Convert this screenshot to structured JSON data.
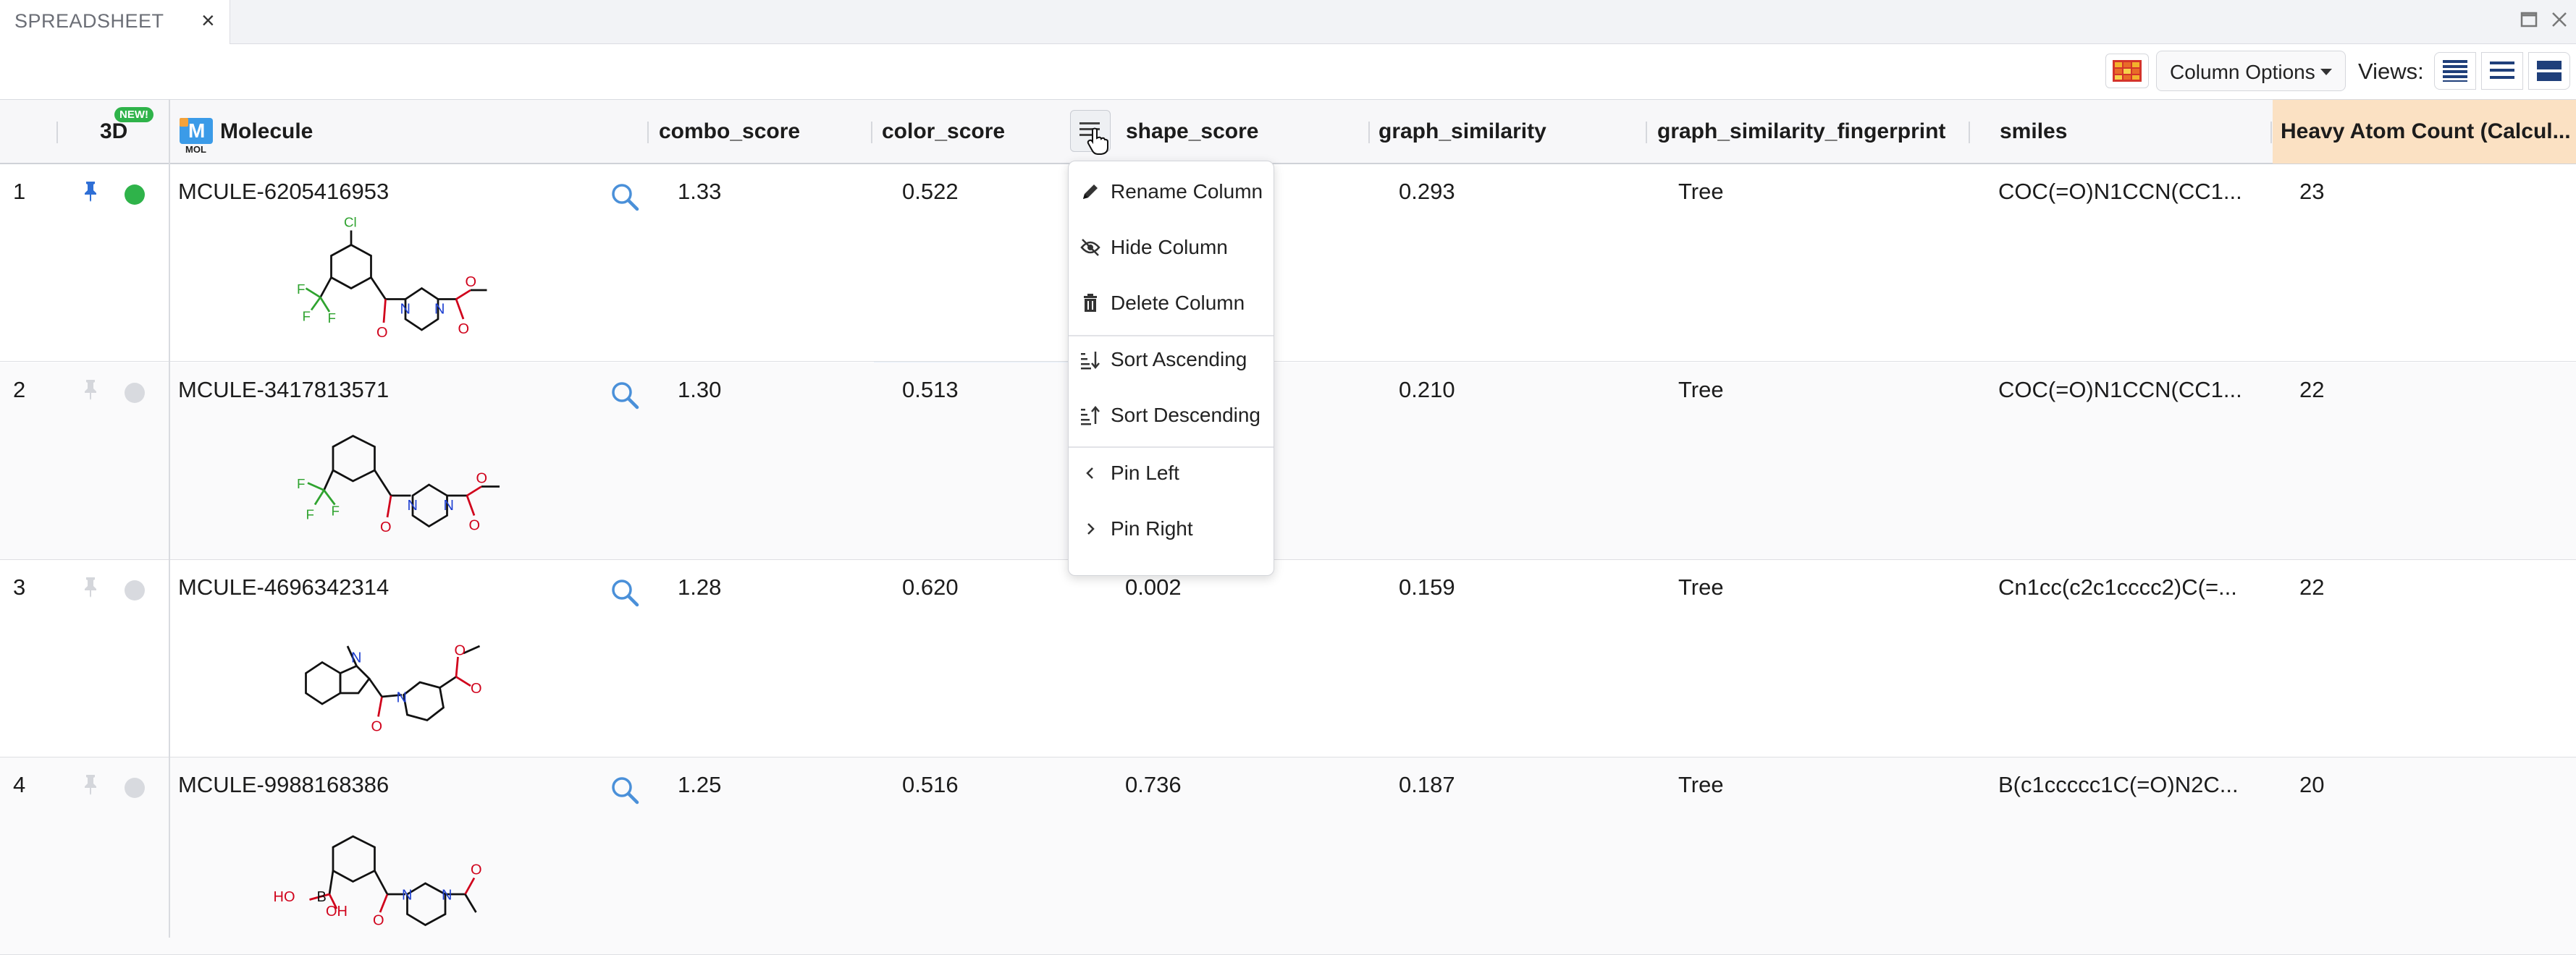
{
  "tab": {
    "title": "SPREADSHEET",
    "close": "×"
  },
  "toolbar": {
    "column_options": "Column Options",
    "views_label": "Views:"
  },
  "header": {
    "threed": "3D",
    "new_badge": "NEW!",
    "mol_badge": "MOL",
    "mol_letter": "M",
    "molecule": "Molecule",
    "combo_score": "combo_score",
    "color_score": "color_score",
    "shape_score": "shape_score",
    "graph_similarity": "graph_similarity",
    "graph_similarity_fingerprint": "graph_similarity_fingerprint",
    "smiles": "smiles",
    "heavy_atom_count": "Heavy Atom Count (Calcul..."
  },
  "menu": {
    "items": [
      {
        "label": "Rename Column",
        "icon": "pencil-icon"
      },
      {
        "label": "Hide Column",
        "icon": "eye-off-icon"
      },
      {
        "label": "Delete Column",
        "icon": "trash-icon"
      },
      {
        "label": "Sort Ascending",
        "icon": "sort-ascending-icon"
      },
      {
        "label": "Sort Descending",
        "icon": "sort-descending-icon"
      },
      {
        "label": "Pin Left",
        "icon": "chevron-left-icon"
      },
      {
        "label": "Pin Right",
        "icon": "chevron-right-icon"
      }
    ]
  },
  "rows": [
    {
      "num": "1",
      "pinned": true,
      "status": "active",
      "id": "MCULE-6205416953",
      "combo": "1.33",
      "color": "0.522",
      "shape": "",
      "graph": "0.293",
      "fingerprint": "Tree",
      "smiles": "COC(=O)N1CCN(CC1...",
      "heavy": "23"
    },
    {
      "num": "2",
      "pinned": false,
      "status": "inactive",
      "id": "MCULE-3417813571",
      "combo": "1.30",
      "color": "0.513",
      "shape": "",
      "graph": "0.210",
      "fingerprint": "Tree",
      "smiles": "COC(=O)N1CCN(CC1...",
      "heavy": "22"
    },
    {
      "num": "3",
      "pinned": false,
      "status": "inactive",
      "id": "MCULE-4696342314",
      "combo": "1.28",
      "color": "0.620",
      "shape": "0.002",
      "graph": "0.159",
      "fingerprint": "Tree",
      "smiles": "Cn1cc(c2c1cccc2)C(=...",
      "heavy": "22"
    },
    {
      "num": "4",
      "pinned": false,
      "status": "inactive",
      "id": "MCULE-9988168386",
      "combo": "1.25",
      "color": "0.516",
      "shape": "0.736",
      "graph": "0.187",
      "fingerprint": "Tree",
      "smiles": "B(c1ccccc1C(=O)N2C...",
      "heavy": "20"
    }
  ],
  "molecule_labels": {
    "cl": "Cl",
    "f": "F",
    "o": "O",
    "n": "N",
    "b": "B",
    "ho": "HO",
    "oh": "OH"
  },
  "colors": {
    "accent": "#4a90d9",
    "pin_active": "#2f6fd6",
    "status_active": "#2fb34a",
    "heavy_header": "#fbe1c3",
    "badge": "#2fb34a"
  }
}
